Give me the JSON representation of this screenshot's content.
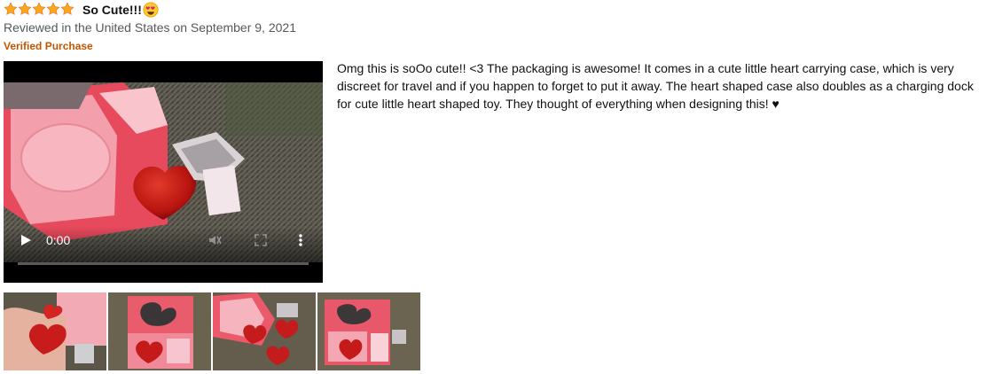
{
  "review": {
    "rating": 5,
    "rating_max": 5,
    "title": "So Cute!!!",
    "reviewed_line": "Reviewed in the United States on September 9, 2021",
    "badge": "Verified Purchase",
    "body": " Omg this is soOo cute!! <3 The packaging is awesome! It comes in a cute little heart carrying case, which is very discreet for travel and if you happen to forget to put it away. The heart shaped case also doubles as a charging dock for cute little heart shaped toy. They thought of everything when designing this! ♥"
  },
  "video": {
    "time": "0:00",
    "play_icon": "play-icon",
    "volume_icon": "volume-icon",
    "fullscreen_icon": "fullscreen-icon",
    "more_icon": "more-vertical-icon",
    "progress": 0
  },
  "colors": {
    "star": "#ffa41c",
    "star_outline": "#de7921",
    "badge": "#c45500",
    "meta_text": "#565959",
    "text": "#0f1111"
  },
  "thumbnails": [
    {
      "name": "review-image-1"
    },
    {
      "name": "review-image-2"
    },
    {
      "name": "review-image-3"
    },
    {
      "name": "review-image-4"
    }
  ]
}
